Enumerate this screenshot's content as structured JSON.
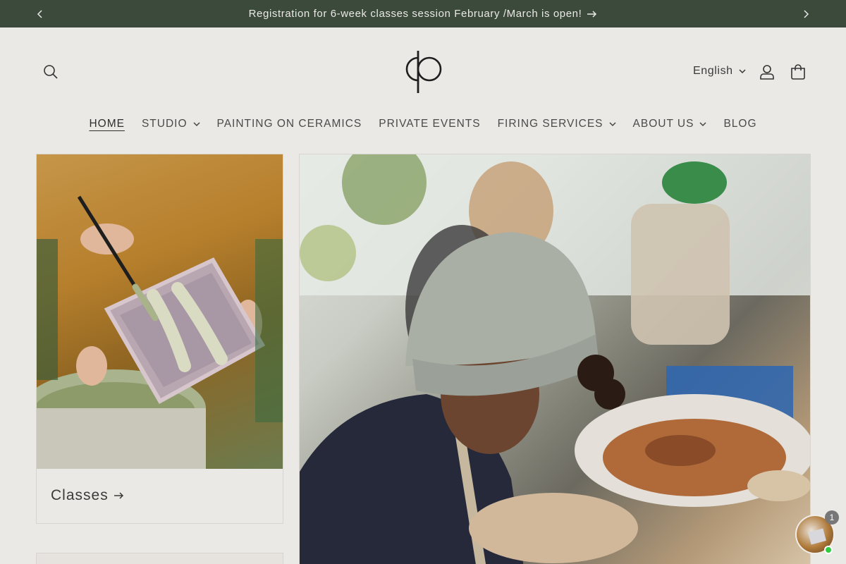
{
  "announcement": {
    "text": "Registration for 6-week classes session February /March is open!"
  },
  "header": {
    "language": "English",
    "logo_alt": "ceramic studio logo"
  },
  "nav": {
    "items": [
      {
        "label": "HOME"
      },
      {
        "label": "STUDIO"
      },
      {
        "label": "PAINTING ON CERAMICS"
      },
      {
        "label": "PRIVATE EVENTS"
      },
      {
        "label": "FIRING SERVICES"
      },
      {
        "label": "ABOUT US"
      },
      {
        "label": "BLOG"
      }
    ]
  },
  "cards": {
    "classes_label": "Classes"
  },
  "chat": {
    "badge_count": "1"
  },
  "colors": {
    "announcement_bg": "#3b4a3a",
    "page_bg": "#ebe9e6"
  }
}
